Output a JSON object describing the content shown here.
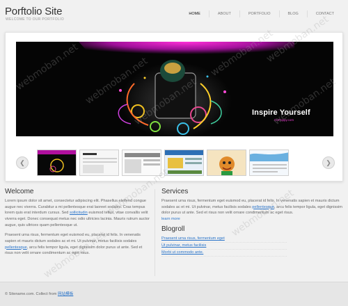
{
  "header": {
    "title": "Porftolio Site",
    "tagline": "WELCOME TO OUR PORTFOLIO",
    "nav": [
      {
        "label": "HOME",
        "active": true
      },
      {
        "label": "ABOUT",
        "active": false
      },
      {
        "label": "PORTFOLIO",
        "active": false
      },
      {
        "label": "BLOG",
        "active": false
      },
      {
        "label": "CONTACT",
        "active": false
      }
    ]
  },
  "slider": {
    "banner_title": "Inspire Yourself",
    "banner_subtitle": "GoPoppy.com",
    "accent_color": "#e020c8",
    "prev_icon": "chevron-left-icon",
    "next_icon": "chevron-right-icon",
    "thumbnail_count": 6
  },
  "watermark": "webmoban.net",
  "welcome": {
    "heading": "Welcome",
    "paragraph1_text": "Lorem ipsum dolor sit amet, consectetur adipiscing elit. Phasellus eleifend congue augue nec viverra. Curabitur a mi pellentesque erat laoreet sodales. Cras tempus lorem quis erat interdum cursus. Sed",
    "paragraph1_link": "sollicitudin",
    "paragraph1_text2": "euismod tellus, vitae convallis velit viverra eget. Donec consequat metus nec odio ultricies lacinia. Mauris rutrum auctor augue, quis ultrices quam pellentesque ut.",
    "paragraph2_text": "Praesent urna risus, fermentum eget euismod eu, placerat id felis. In venenatis sapien et mauris dictum sodales ac et mi. Ut pulvinar, metus facilisis sodales",
    "paragraph2_link": "pellentesque",
    "paragraph2_text2": ", arcu felis tempor ligula, eget dignissim dolor purus ut ante. Sed et risus non velit ornare condimentum ac eget risus."
  },
  "services": {
    "heading": "Services",
    "text": "Praesent urna risus, fermentum eget euismod eu, placerat id felis. In venenatis sapien et mauris dictum sodales ac et mi. Ut pulvinar, metus facilisis sodales",
    "link": "pellentesque",
    "text2": ", arcu felis tempor ligula, eget dignissim dolor purus ut ante. Sed et risus non velit ornare condimentum ac eget risus.",
    "more": "learn more"
  },
  "blogroll": {
    "heading": "Blogroll",
    "items": [
      "Praesent urna risus, fermentum eget",
      "Ut pulvinar, metus facilisis",
      "Morbi ut commodo ante."
    ]
  },
  "footer": {
    "text": "© Sitename.com. Collect from",
    "link": "网站模板"
  }
}
